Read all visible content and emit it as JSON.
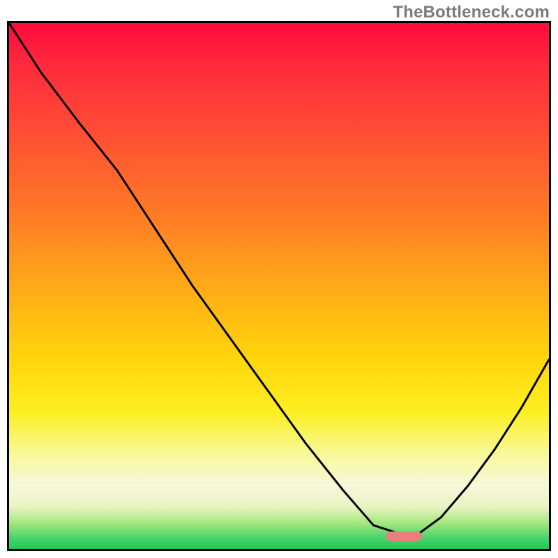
{
  "watermark": "TheBottleneck.com",
  "colors": {
    "frame_border": "#000000",
    "curve_stroke": "#000000",
    "marker_fill": "#e8817c",
    "gradient_top": "#ff0b3b",
    "gradient_bottom": "#1ec956"
  },
  "marker": {
    "x_frac": 0.725,
    "y_frac": 0.968
  },
  "chart_data": {
    "type": "line",
    "title": "",
    "xlabel": "",
    "ylabel": "",
    "xlim": [
      0,
      1
    ],
    "ylim": [
      0,
      1
    ],
    "grid": false,
    "legend": false,
    "background": "rainbow-gradient (red top → green bottom)",
    "series": [
      {
        "name": "curve",
        "x": [
          0.0,
          0.06,
          0.13,
          0.2,
          0.27,
          0.34,
          0.41,
          0.48,
          0.55,
          0.62,
          0.675,
          0.72,
          0.76,
          0.8,
          0.85,
          0.9,
          0.95,
          1.0
        ],
        "y": [
          1.0,
          0.905,
          0.81,
          0.72,
          0.61,
          0.5,
          0.4,
          0.3,
          0.2,
          0.11,
          0.045,
          0.03,
          0.03,
          0.06,
          0.12,
          0.19,
          0.27,
          0.36
        ]
      }
    ],
    "marker": {
      "shape": "rounded-rect",
      "color": "#e8817c",
      "x": 0.725,
      "y": 0.032
    }
  }
}
